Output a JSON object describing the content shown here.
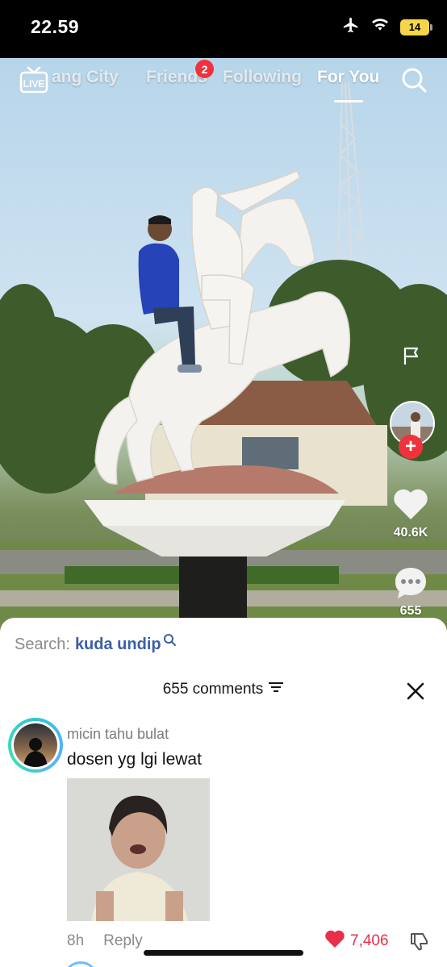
{
  "status_bar": {
    "time": "22.59",
    "battery": "14",
    "icons": [
      "airplane-icon",
      "wifi-icon",
      "battery-icon"
    ]
  },
  "top_nav": {
    "live_label": "LIVE",
    "tabs": [
      {
        "label": "ang City",
        "active": false
      },
      {
        "label": "Friends",
        "active": false,
        "badge": "2"
      },
      {
        "label": "Following",
        "active": false
      },
      {
        "label": "For You",
        "active": true
      }
    ]
  },
  "right_rail": {
    "like_count": "40.6K",
    "comment_count": "655"
  },
  "comment_sheet": {
    "search_prefix": "Search:",
    "search_term": "kuda undip",
    "comments_count_label": "655 comments",
    "comments": [
      {
        "username": "micin tahu bulat",
        "text": "dosen yg lgi lewat",
        "time": "8h",
        "reply_label": "Reply",
        "likes": "7,406"
      }
    ]
  },
  "colors": {
    "accent_red": "#f0323c",
    "like_red": "#e8304a",
    "search_term_blue": "#3a5fa6"
  }
}
